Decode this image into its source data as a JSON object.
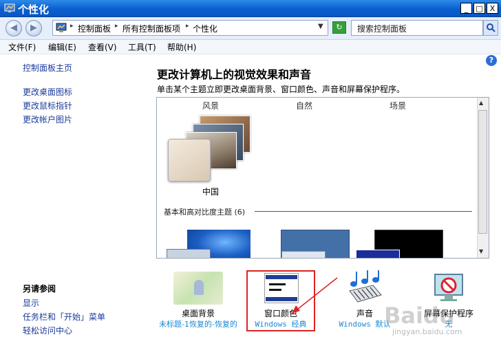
{
  "window": {
    "title": "个性化",
    "controls": {
      "minimize": "_",
      "maximize": "□",
      "close": "X"
    }
  },
  "nav": {
    "back_glyph": "◀",
    "forward_glyph": "▶",
    "breadcrumbs": [
      "控制面板",
      "所有控制面板项",
      "个性化"
    ],
    "separator": "▸",
    "dropdown_glyph": "▼",
    "refresh_glyph": "↻",
    "search_placeholder": "搜索控制面板"
  },
  "menu": [
    "文件(F)",
    "编辑(E)",
    "查看(V)",
    "工具(T)",
    "帮助(H)"
  ],
  "sidebar": {
    "home": "控制面板主页",
    "links": [
      "更改桌面图标",
      "更改鼠标指针",
      "更改帐户图片"
    ],
    "see_also_title": "另请参阅",
    "see_also": [
      "显示",
      "任务栏和「开始」菜单",
      "轻松访问中心"
    ]
  },
  "help_label": "?",
  "main": {
    "title": "更改计算机上的视觉效果和声音",
    "subtitle": "单击某个主题立即更改桌面背景、窗口颜色、声音和屏幕保护程序。"
  },
  "themes": {
    "columns": [
      "风景",
      "自然",
      "场景"
    ],
    "selected_theme": "中国",
    "section_title": "基本和高对比度主题 (6)",
    "scroll_up": "▲",
    "scroll_down": "▼"
  },
  "bottom": [
    {
      "label": "桌面背景",
      "sub": "未标题-1恢复的-恢复的"
    },
    {
      "label": "窗口颜色",
      "sub": "Windows 经典"
    },
    {
      "label": "声音",
      "sub": "Windows 默认"
    },
    {
      "label": "屏幕保护程序",
      "sub": "无"
    }
  ],
  "watermark": {
    "logo": "Baidu",
    "url": "jingyan.baidu.com"
  },
  "colors": {
    "titlebar": "#0a5fd0",
    "link": "#1a3a99",
    "highlight": "#d22222"
  }
}
